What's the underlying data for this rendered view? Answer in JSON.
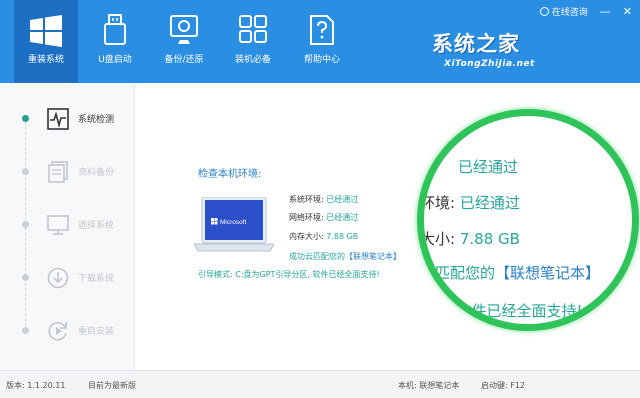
{
  "nav": [
    {
      "label": "重装系统",
      "icon": "windows-icon"
    },
    {
      "label": "U盘启动",
      "icon": "usb-drive-icon"
    },
    {
      "label": "备份/还原",
      "icon": "backup-restore-icon"
    },
    {
      "label": "装机必备",
      "icon": "apps-grid-icon"
    },
    {
      "label": "帮助中心",
      "icon": "help-document-icon"
    }
  ],
  "topbar": {
    "consult_label": "在线咨询",
    "minimize": "—",
    "close": "✕"
  },
  "brand": {
    "name_cn": "系统之家",
    "name_en": "XiTongZhiJia.net"
  },
  "steps": [
    {
      "label": "系统检测",
      "icon": "monitor-pulse-icon",
      "active": true
    },
    {
      "label": "资料备份",
      "icon": "document-copy-icon",
      "active": false
    },
    {
      "label": "选择系统",
      "icon": "desktop-icon",
      "active": false
    },
    {
      "label": "下载系统",
      "icon": "download-icon",
      "active": false
    },
    {
      "label": "重启安装",
      "icon": "restart-icon",
      "active": false
    }
  ],
  "check": {
    "title": "检查本机环境:",
    "laptop_logo": "Microsoft",
    "rows": [
      {
        "key": "系统环境:",
        "value": "已经通过"
      },
      {
        "key": "网络环境:",
        "value": "已经通过"
      },
      {
        "key": "内存大小:",
        "value": "7.88 GB"
      }
    ],
    "match_prefix": "成功云匹配您的",
    "model": "【联想笔记本】",
    "boot_mode": "引导模式: C:盘为GPT引导分区, 软件已经全面支持!"
  },
  "magnifier": {
    "row1": "已经通过",
    "row2_key": "环境:",
    "row2_value": "已经通过",
    "row3_key": "大小:",
    "row3_value": "7.88 GB",
    "row4_prefix": "云匹配您的",
    "row4_model": "【联想笔记本】",
    "row5": "区, 软件已经全面支持!"
  },
  "footer": {
    "version": "版本: 1.1.20.11",
    "version_status": "目前为最新版",
    "machine": "本机: 联想笔记本",
    "hotkey": "启动键: F12"
  },
  "colors": {
    "header": "#2a8ee3",
    "active_tab": "#1d6fc3",
    "ok_green": "#26a59a",
    "accent_blue": "#2a7fc8",
    "magnifier_ring": "#2fc45a"
  }
}
